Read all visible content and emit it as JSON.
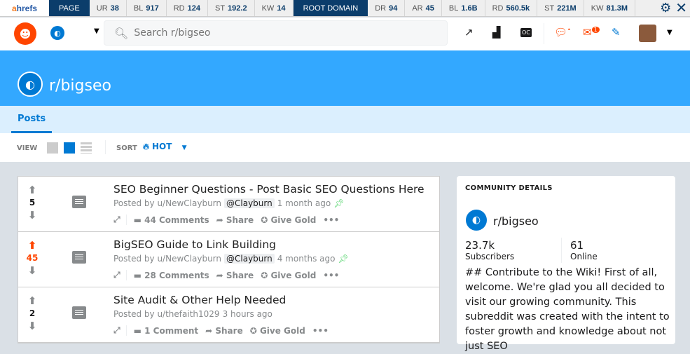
{
  "ahrefs": {
    "logo_a": "a",
    "logo_rest": "hrefs",
    "page_label": "PAGE",
    "page_metrics": [
      {
        "k": "UR",
        "v": "38"
      },
      {
        "k": "BL",
        "v": "917"
      },
      {
        "k": "RD",
        "v": "124"
      },
      {
        "k": "ST",
        "v": "192.2"
      },
      {
        "k": "KW",
        "v": "14"
      }
    ],
    "root_label": "ROOT DOMAIN",
    "root_metrics": [
      {
        "k": "DR",
        "v": "94"
      },
      {
        "k": "AR",
        "v": "45"
      },
      {
        "k": "BL",
        "v": "1.6B"
      },
      {
        "k": "RD",
        "v": "560.5k"
      },
      {
        "k": "ST",
        "v": "221M"
      },
      {
        "k": "KW",
        "v": "81.3M"
      }
    ]
  },
  "header": {
    "search_placeholder": "Search r/bigseo",
    "chat_badge": "•",
    "mail_badge": "1"
  },
  "banner": {
    "subreddit": "r/bigseo"
  },
  "tabs": {
    "posts": "Posts"
  },
  "view": {
    "view_label": "VIEW",
    "sort_label": "SORT",
    "sort_value": "HOT"
  },
  "posts": [
    {
      "votes": "5",
      "title": "SEO Beginner Questions - Post Basic SEO Questions Here",
      "posted_by": "Posted by u/NewClayburn",
      "flair": "@Clayburn",
      "time": "1 month ago",
      "pinned": true,
      "comments": "44 Comments",
      "share": "Share",
      "gold": "Give Gold",
      "upvoted": false
    },
    {
      "votes": "45",
      "title": "BigSEO Guide to Link Building",
      "posted_by": "Posted by u/NewClayburn",
      "flair": "@Clayburn",
      "time": "4 months ago",
      "pinned": true,
      "comments": "28 Comments",
      "share": "Share",
      "gold": "Give Gold",
      "upvoted": true
    },
    {
      "votes": "2",
      "title": "Site Audit & Other Help Needed",
      "posted_by": "Posted by u/thefaith1029",
      "flair": "",
      "time": "3 hours ago",
      "pinned": false,
      "comments": "1 Comment",
      "share": "Share",
      "gold": "Give Gold",
      "upvoted": false
    }
  ],
  "sidebar": {
    "heading": "COMMUNITY DETAILS",
    "name": "r/bigseo",
    "subscribers": "23.7k",
    "subscribers_label": "Subscribers",
    "online": "61",
    "online_label": "Online",
    "description": "## Contribute to the Wiki! First of all, welcome. We're glad you all decided to visit our growing community. This subreddit was created with the intent to foster growth and knowledge about not just SEO"
  }
}
